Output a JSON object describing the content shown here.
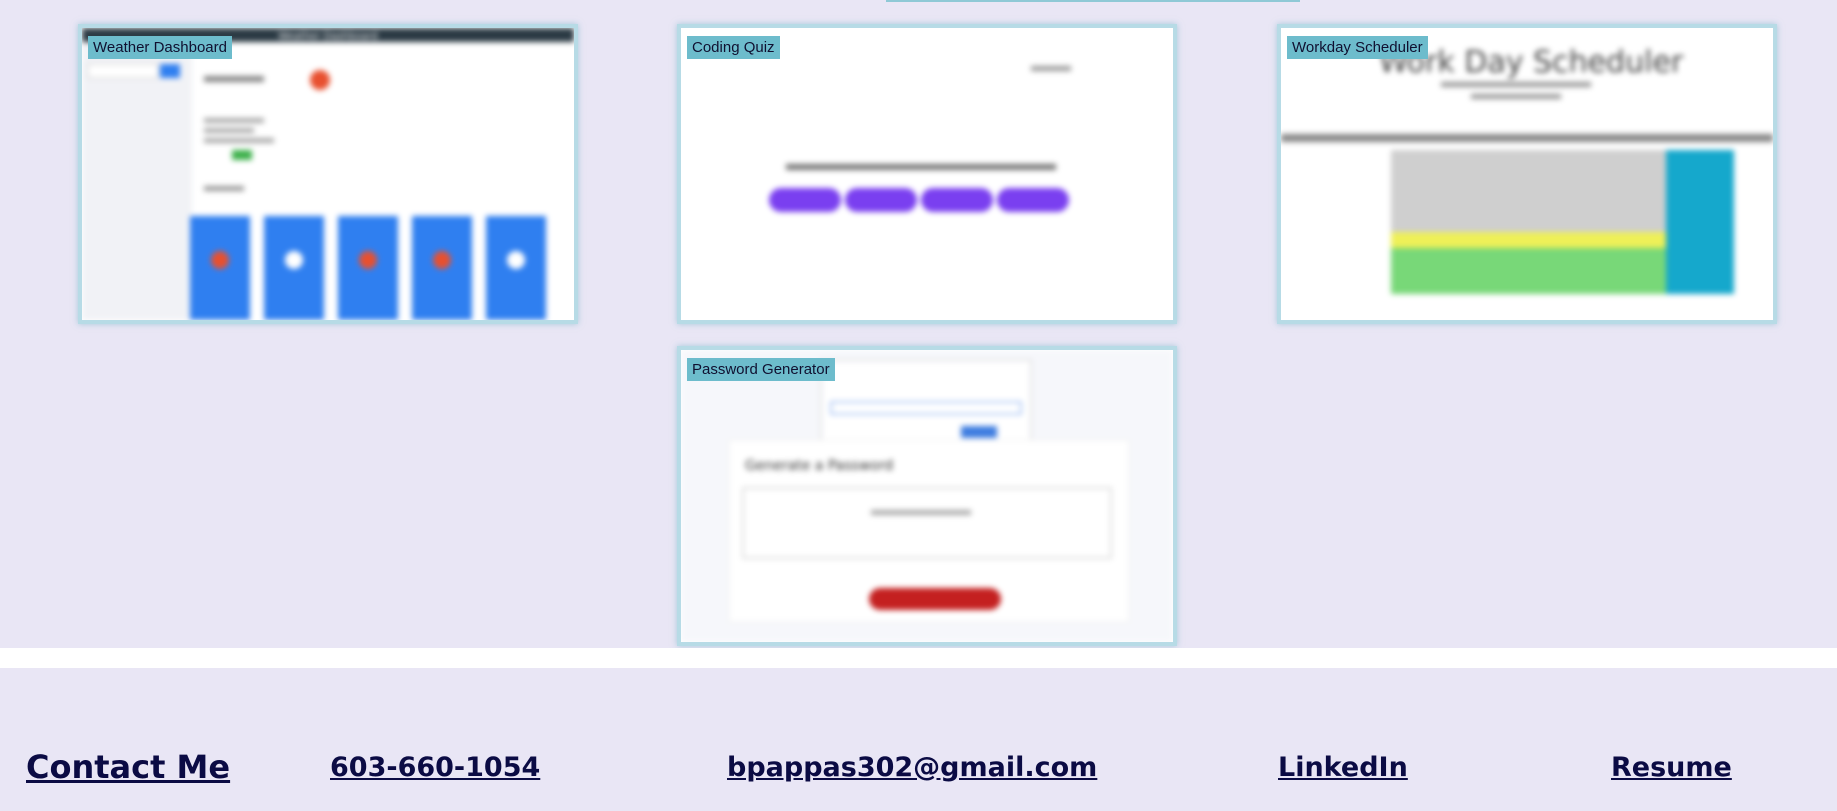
{
  "projects": [
    {
      "id": "weather",
      "label": "Weather Dashboard",
      "heading": "Weather Dashboard"
    },
    {
      "id": "quiz",
      "label": "Coding Quiz"
    },
    {
      "id": "scheduler",
      "label": "Workday Scheduler",
      "heading": "Work Day Scheduler"
    },
    {
      "id": "password",
      "label": "Password Generator",
      "heading": "Generate a Password"
    }
  ],
  "footer": {
    "contact_heading": "Contact Me",
    "phone": "603-660-1054",
    "email": "bpappas302@gmail.com",
    "linkedin": "LinkedIn",
    "resume": "Resume"
  },
  "colors": {
    "page_bg": "#e9e6f5",
    "label_bg": "#6dbccc",
    "link": "#0b0b44",
    "card_border": "#b7dbe6"
  }
}
